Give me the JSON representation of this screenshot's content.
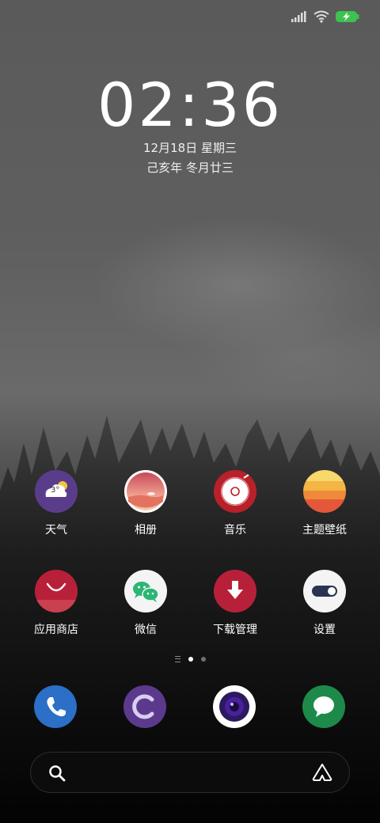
{
  "status_bar": {
    "signal_icon": "signal-bars-icon",
    "wifi_icon": "wifi-icon",
    "battery_icon": "battery-charging-icon",
    "battery_color": "#3dc24f"
  },
  "clock": {
    "hours": "02",
    "separator": ":",
    "minutes": "36"
  },
  "date": {
    "solar": "12月18日 星期三",
    "lunar": "己亥年 冬月廿三"
  },
  "apps": [
    {
      "label": "天气",
      "icon": "weather-icon",
      "color": "#5a3d8a",
      "badge": "3°"
    },
    {
      "label": "相册",
      "icon": "gallery-icon",
      "color": "#e8a0a0"
    },
    {
      "label": "音乐",
      "icon": "music-icon",
      "color": "#b8202a"
    },
    {
      "label": "主题壁纸",
      "icon": "themes-icon",
      "color": "#f0b030"
    },
    {
      "label": "应用商店",
      "icon": "app-store-icon",
      "color": "#b8203a"
    },
    {
      "label": "微信",
      "icon": "wechat-icon",
      "color": "#2bb673"
    },
    {
      "label": "下载管理",
      "icon": "download-icon",
      "color": "#b8203a"
    },
    {
      "label": "设置",
      "icon": "settings-toggle-icon",
      "color": "#2a3450"
    }
  ],
  "page_indicator": {
    "count": 2,
    "active": 1
  },
  "dock": [
    {
      "icon": "phone-icon",
      "color": "#2b6fc6"
    },
    {
      "icon": "browser-icon",
      "color": "#5b3a8e"
    },
    {
      "icon": "camera-icon",
      "color": "#3a1a7a"
    },
    {
      "icon": "messages-icon",
      "color": "#1e8a4a"
    }
  ],
  "search_bar": {
    "search_icon": "search-icon",
    "assistant_icon": "assistant-icon"
  }
}
